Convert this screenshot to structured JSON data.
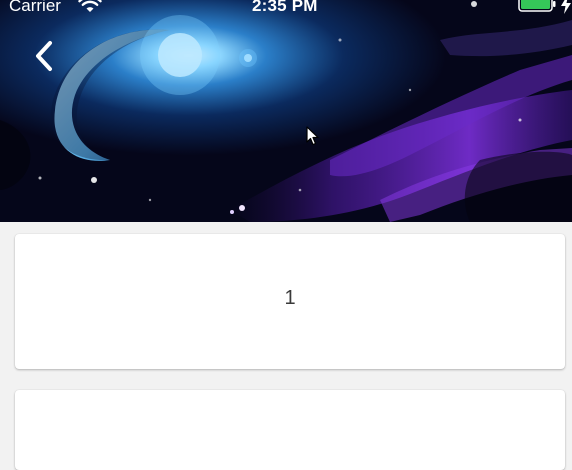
{
  "status_bar": {
    "carrier": "Carrier",
    "time": "2:35 PM",
    "battery_color": "#35c759",
    "wifi_icon": "wifi-icon",
    "charging_icon": "bolt-icon"
  },
  "header": {
    "back_icon": "chevron-left-icon"
  },
  "cards": [
    {
      "label": "1"
    },
    {
      "label": ""
    }
  ],
  "colors": {
    "background": "#f2f2f2",
    "card": "#ffffff",
    "card_text": "#3a3a3a"
  }
}
